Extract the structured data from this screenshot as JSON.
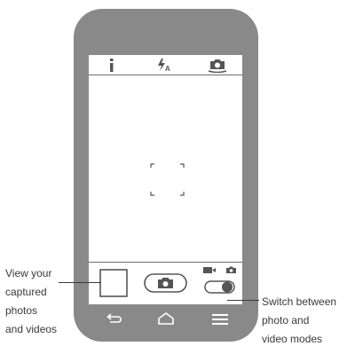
{
  "callouts": {
    "gallery": {
      "lines": [
        "View your",
        "captured",
        "photos",
        "and videos"
      ]
    },
    "mode_switch": {
      "lines": [
        "Switch between",
        "photo and",
        "video modes"
      ]
    }
  },
  "top_icons": [
    "info-icon",
    "flash-auto-icon",
    "switch-camera-icon"
  ],
  "bottom_icons": [
    "thumbnail-placeholder",
    "camera-shutter-icon",
    "video-icon",
    "camera-mode-icon",
    "photo-video-toggle"
  ],
  "nav_icons": [
    "back-icon",
    "home-icon",
    "menu-icon"
  ],
  "colors": {
    "phone_body": "#898989",
    "screen": "#ffffff",
    "icon": "#555555",
    "text": "#3a3a3a"
  },
  "mode_toggle": {
    "state": "video"
  }
}
